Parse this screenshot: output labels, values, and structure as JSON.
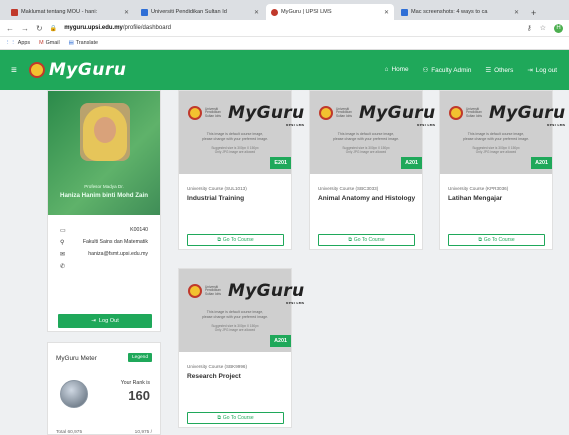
{
  "browser": {
    "tabs": [
      {
        "title": "Maklumat tentang MOU - hani:",
        "favicon_color": "#c0392b"
      },
      {
        "title": "Universiti Pendidikan Sultan Id",
        "favicon_color": "#2f6fd6"
      },
      {
        "title": "MyGuru | UPSI LMS",
        "favicon_color": "#c0392b"
      },
      {
        "title": "Mac screenshots: 4 ways to ca",
        "favicon_color": "#2f6fd6"
      }
    ],
    "new_tab": "+",
    "url_domain": "myguru.upsi.edu.my",
    "url_path": "/profile/dashboard",
    "profile_initial": "H",
    "bookmarks": [
      "Apps",
      "Gmail",
      "Translate"
    ]
  },
  "nav": {
    "brand": "MyGuru",
    "links": [
      "Home",
      "Faculty Admin",
      "Others",
      "Log out"
    ],
    "accent_color": "#1fa85a"
  },
  "profile": {
    "role": "Profesor Madya Dr.",
    "name": "Haniza Hanim binti Mohd Zain",
    "staff_id": "K00140",
    "faculty": "Fakulti Sains dan Matematik",
    "email": "haniza@fsmt.upsi.edu.my",
    "phone": "",
    "logout_label": "Log Out"
  },
  "meter": {
    "title": "MyGuru Meter",
    "legend_label": "Legend",
    "rank_label": "Your Rank is",
    "rank_value": "160",
    "footer_left": "Total 60,975",
    "footer_right": "10,975 /"
  },
  "course_image": {
    "brand": "MyGuru",
    "lms": "UPSI LMS",
    "uni_line": "Universiti Pendidikan Sultan Idris",
    "note_line1": "This image is default course image,",
    "note_line2": "please change with your preferred image.",
    "suggest_line1": "Suggested size is 300px X 150px",
    "suggest_line2": "Only JPG image are allowed"
  },
  "courses": [
    {
      "code": "University Course (SUL1013)",
      "name": "Industrial Training",
      "semester": "E201",
      "button": "Go To Course"
    },
    {
      "code": "University Course (SBC3033)",
      "name": "Animal Anatomy and Histology",
      "semester": "A201",
      "button": "Go To Course"
    },
    {
      "code": "University Course (KPR3036)",
      "name": "Latihan Mengajar",
      "semester": "A201",
      "button": "Go To Course"
    },
    {
      "code": "University Course (SBK9996)",
      "name": "Research Project",
      "semester": "A201",
      "button": "Go To Course"
    }
  ]
}
